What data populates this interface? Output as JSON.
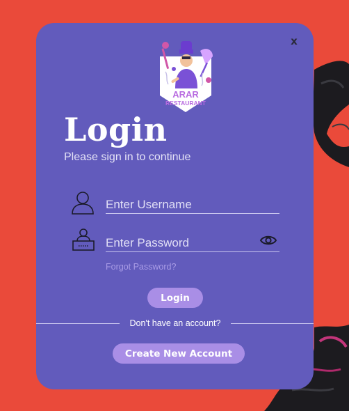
{
  "dialog": {
    "close_label": "x",
    "title": "Login",
    "subtitle": "Please sign in to continue"
  },
  "logo": {
    "line1": "ARAR",
    "line2": "RESTAURANT"
  },
  "username": {
    "placeholder": "Enter Username",
    "icon": "user-icon"
  },
  "password": {
    "placeholder": "Enter Password",
    "icon": "password-icon",
    "toggle_icon": "eye-icon"
  },
  "links": {
    "forgot_password": "Forgot Password?"
  },
  "buttons": {
    "login": "Login",
    "create_account": "Create New Account"
  },
  "divider": {
    "text": "Don't have an account?"
  },
  "colors": {
    "background": "#ea4a3a",
    "card": "#625bbc",
    "button": "#a98ee6",
    "link": "#a99ce6"
  }
}
